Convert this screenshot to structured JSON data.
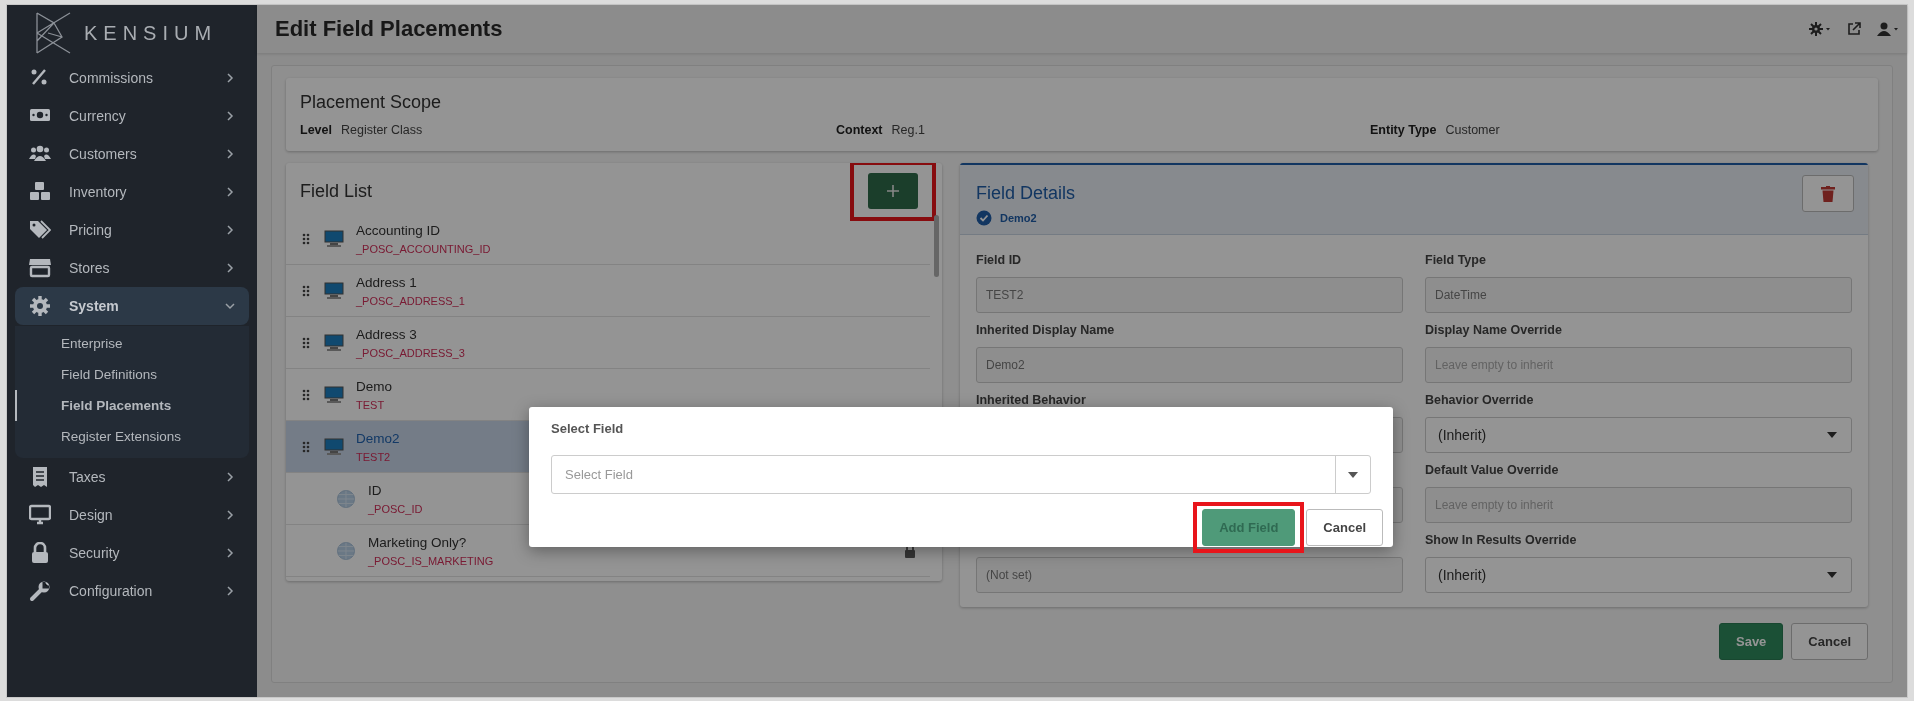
{
  "sidebar": {
    "logo": "KENSIUM",
    "items": [
      {
        "label": "Commissions",
        "expanded": false
      },
      {
        "label": "Currency",
        "expanded": false
      },
      {
        "label": "Customers",
        "expanded": false
      },
      {
        "label": "Inventory",
        "expanded": false
      },
      {
        "label": "Pricing",
        "expanded": false
      },
      {
        "label": "Stores",
        "expanded": false
      },
      {
        "label": "System",
        "expanded": true,
        "children": [
          {
            "label": "Enterprise",
            "selected": false
          },
          {
            "label": "Field Definitions",
            "selected": false
          },
          {
            "label": "Field Placements",
            "selected": true
          },
          {
            "label": "Register Extensions",
            "selected": false
          }
        ]
      },
      {
        "label": "Taxes",
        "expanded": false
      },
      {
        "label": "Design",
        "expanded": false
      },
      {
        "label": "Security",
        "expanded": false
      },
      {
        "label": "Configuration",
        "expanded": false
      }
    ]
  },
  "header": {
    "title": "Edit Field Placements"
  },
  "scope": {
    "title": "Placement Scope",
    "fields": [
      {
        "label": "Level",
        "value": "Register Class"
      },
      {
        "label": "Context",
        "value": "Reg.1"
      },
      {
        "label": "Entity Type",
        "value": "Customer"
      }
    ]
  },
  "field_list": {
    "title": "Field List",
    "add_highlighted": true,
    "items": [
      {
        "name": "Accounting ID",
        "code": "_POSC_ACCOUNTING_ID",
        "kind": "register",
        "selected": false,
        "locked": false
      },
      {
        "name": "Address 1",
        "code": "_POSC_ADDRESS_1",
        "kind": "register",
        "selected": false,
        "locked": false
      },
      {
        "name": "Address 3",
        "code": "_POSC_ADDRESS_3",
        "kind": "register",
        "selected": false,
        "locked": false
      },
      {
        "name": "Demo",
        "code": "TEST",
        "kind": "register",
        "selected": false,
        "locked": false
      },
      {
        "name": "Demo2",
        "code": "TEST2",
        "kind": "register",
        "selected": true,
        "locked": false
      },
      {
        "name": "ID",
        "code": "_POSC_ID",
        "kind": "global",
        "selected": false,
        "locked": false
      },
      {
        "name": "Marketing Only?",
        "code": "_POSC_IS_MARKETING",
        "kind": "global",
        "selected": false,
        "locked": true
      }
    ]
  },
  "details": {
    "title": "Field Details",
    "subtitle": "Demo2",
    "fields": [
      {
        "label": "Field ID",
        "value": "TEST2",
        "kind": "text"
      },
      {
        "label": "Field Type",
        "value": "DateTime",
        "kind": "text"
      },
      {
        "label": "Inherited Display Name",
        "value": "Demo2",
        "kind": "text"
      },
      {
        "label": "Display Name Override",
        "placeholder": "Leave empty to inherit",
        "kind": "text"
      },
      {
        "label": "Inherited Behavior",
        "kind": "text"
      },
      {
        "label": "Behavior Override",
        "value": "(Inherit)",
        "kind": "select"
      },
      {
        "kind": "text"
      },
      {
        "label": "Default Value Override",
        "placeholder": "Leave empty to inherit",
        "kind": "text"
      },
      {
        "value": "(Not set)",
        "kind": "text"
      },
      {
        "label": "Show In Results Override",
        "value": "(Inherit)",
        "kind": "select"
      }
    ],
    "buttons": [
      {
        "label": "Save",
        "kind": "primary"
      },
      {
        "label": "Cancel",
        "kind": "secondary"
      }
    ]
  },
  "modal": {
    "title": "Select Field",
    "select": {
      "placeholder": "Select Field"
    },
    "buttons": [
      {
        "label": "Add Field",
        "kind": "primary",
        "highlighted": true
      },
      {
        "label": "Cancel",
        "kind": "secondary",
        "highlighted": false
      }
    ]
  }
}
